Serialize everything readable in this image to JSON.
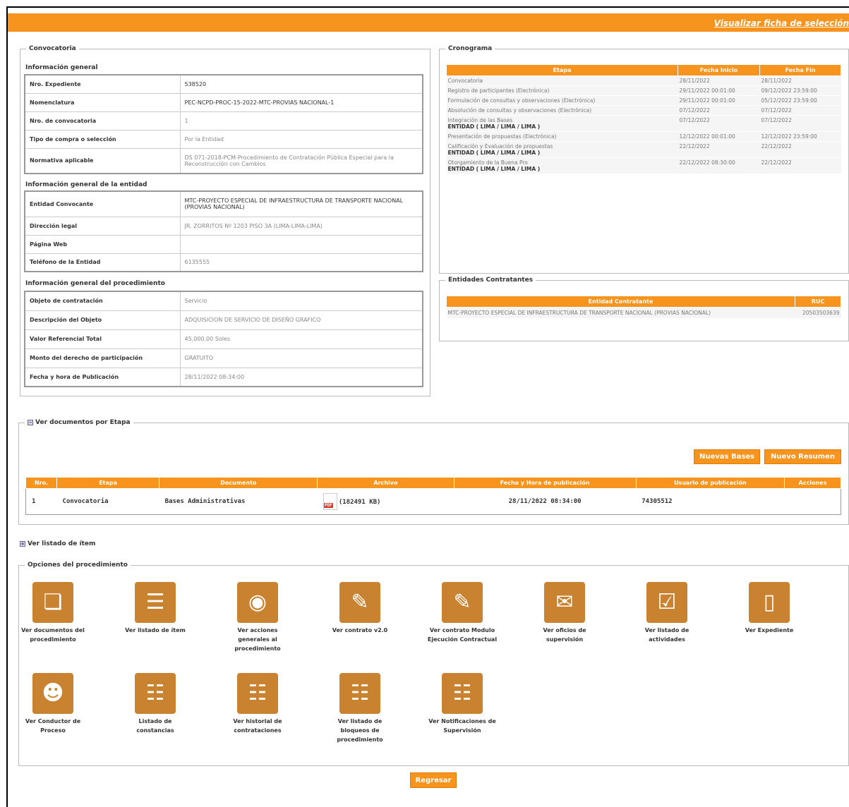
{
  "header": {
    "link": "Visualizar ficha de selección"
  },
  "convocatoria": {
    "legend": "Convocatoria",
    "general_title": "Información general",
    "general": [
      {
        "k": "Nro. Expediente",
        "v": "538520",
        "dark": true
      },
      {
        "k": "Nomenclatura",
        "v": "PEC-NCPD-PROC-15-2022-MTC-PROVIAS NACIONAL-1",
        "dark": true
      },
      {
        "k": "Nro. de convocatoria",
        "v": "1"
      },
      {
        "k": "Tipo de compra o selección",
        "v": "Por la Entidad"
      },
      {
        "k": "Normativa aplicable",
        "v": "DS 071-2018-PCM-Procedimiento de Contratación Pública Especial para la Reconstrucción con Cambios"
      }
    ],
    "entidad_title": "Información general de la entidad",
    "entidad": [
      {
        "k": "Entidad Convocante",
        "v": "MTC-PROYECTO ESPECIAL DE INFRAESTRUCTURA DE TRANSPORTE NACIONAL (PROVIAS NACIONAL)",
        "dark": true
      },
      {
        "k": "Dirección legal",
        "v": "JR. ZORRITOS Nº 1203 PISO 3A (LIMA-LIMA-LIMA)"
      },
      {
        "k": "Página Web",
        "v": ""
      },
      {
        "k": "Teléfono de la Entidad",
        "v": "6135555"
      }
    ],
    "proc_title": "Información general del procedimiento",
    "proc": [
      {
        "k": "Objeto de contratación",
        "v": "Servicio"
      },
      {
        "k": "Descripción del Objeto",
        "v": "ADQUISICION DE SERVICIO DE DISEÑO GRAFICO"
      },
      {
        "k": "Valor Referencial Total",
        "v": "45,000.00 Soles"
      },
      {
        "k": "Monto del derecho de participación",
        "v": "GRATUITO"
      },
      {
        "k": "Fecha y hora de Publicación",
        "v": "28/11/2022 08:34:00"
      }
    ]
  },
  "cronograma": {
    "legend": "Cronograma",
    "headers": [
      "Etapa",
      "Fecha Inicio",
      "Fecha Fin"
    ],
    "rows": [
      {
        "etapa": "Convocatoria",
        "sub": "",
        "ini": "28/11/2022",
        "fin": "28/11/2022"
      },
      {
        "etapa": "Registro de participantes (Electrónica)",
        "sub": "",
        "ini": "29/11/2022 00:01:00",
        "fin": "09/12/2022 23:59:00"
      },
      {
        "etapa": "Formulación de consultas y observaciones (Electrónica)",
        "sub": "",
        "ini": "29/11/2022 00:01:00",
        "fin": "05/12/2022 23:59:00"
      },
      {
        "etapa": "Absolución de consultas y observaciones (Electrónica)",
        "sub": "",
        "ini": "07/12/2022",
        "fin": "07/12/2022"
      },
      {
        "etapa": "Integración de las Bases",
        "sub": "ENTIDAD ( LIMA / LIMA / LIMA )",
        "ini": "07/12/2022",
        "fin": "07/12/2022"
      },
      {
        "etapa": "Presentación de propuestas (Electrónica)",
        "sub": "",
        "ini": "12/12/2022 00:01:00",
        "fin": "12/12/2022 23:59:00"
      },
      {
        "etapa": "Calificación y Evaluación de propuestas",
        "sub": "ENTIDAD ( LIMA / LIMA / LIMA )",
        "ini": "22/12/2022",
        "fin": "22/12/2022"
      },
      {
        "etapa": "Otorgamiento de la Buena Pro",
        "sub": "ENTIDAD ( LIMA / LIMA / LIMA )",
        "ini": "22/12/2022 08:30:00",
        "fin": "22/12/2022"
      }
    ]
  },
  "entidades": {
    "legend": "Entidades Contratantes",
    "headers": [
      "Entidad Contratante",
      "RUC"
    ],
    "rows": [
      {
        "entidad": "MTC-PROYECTO ESPECIAL DE INFRAESTRUCTURA DE TRANSPORTE NACIONAL (PROVIAS NACIONAL)",
        "ruc": "20503503639"
      }
    ]
  },
  "documentos": {
    "legend": "Ver documentos por Etapa",
    "btn_bases": "Nuevas Bases",
    "btn_resumen": "Nuevo Resumen",
    "headers": [
      "Nro.",
      "Etapa",
      "Documento",
      "Archivo",
      "Fecha y Hora de publicación",
      "Usuario de publicación",
      "Acciones"
    ],
    "rows": [
      {
        "nro": "1",
        "etapa": "Convocatoria",
        "doc": "Bases Administrativas",
        "size": "(182491 KB)",
        "fecha": "28/11/2022 08:34:00",
        "usuario": "74305512",
        "acciones": ""
      }
    ]
  },
  "items_toggle": "Ver listado de ítem",
  "opciones": {
    "legend": "Opciones del procedimiento",
    "items": [
      {
        "label": "Ver documentos del procedimiento",
        "icon": "documents-icon"
      },
      {
        "label": "Ver listado de ítem",
        "icon": "numbered-list-icon"
      },
      {
        "label": "Ver acciones generales al procedimiento",
        "icon": "traffic-light-icon"
      },
      {
        "label": "Ver contrato v2.0",
        "icon": "contract-icon"
      },
      {
        "label": "Ver contrato Modulo Ejecución Contractual",
        "icon": "contract-icon"
      },
      {
        "label": "Ver oficios de supervisión",
        "icon": "letter-icon"
      },
      {
        "label": "Ver listado de actividades",
        "icon": "checklist-icon"
      },
      {
        "label": "Ver Expediente",
        "icon": "folder-icon"
      },
      {
        "label": "Ver Conductor de Proceso",
        "icon": "people-icon"
      },
      {
        "label": "Listado de constancias",
        "icon": "hierarchy-icon"
      },
      {
        "label": "Ver historial de contrataciones",
        "icon": "hierarchy-icon"
      },
      {
        "label": "Ver listado de bloqueos de procedimiento",
        "icon": "hierarchy-icon"
      },
      {
        "label": "Ver Notificaciones de Supervisión",
        "icon": "hierarchy-icon"
      }
    ]
  },
  "regresar": "Regresar",
  "pdf_label": "PDF"
}
